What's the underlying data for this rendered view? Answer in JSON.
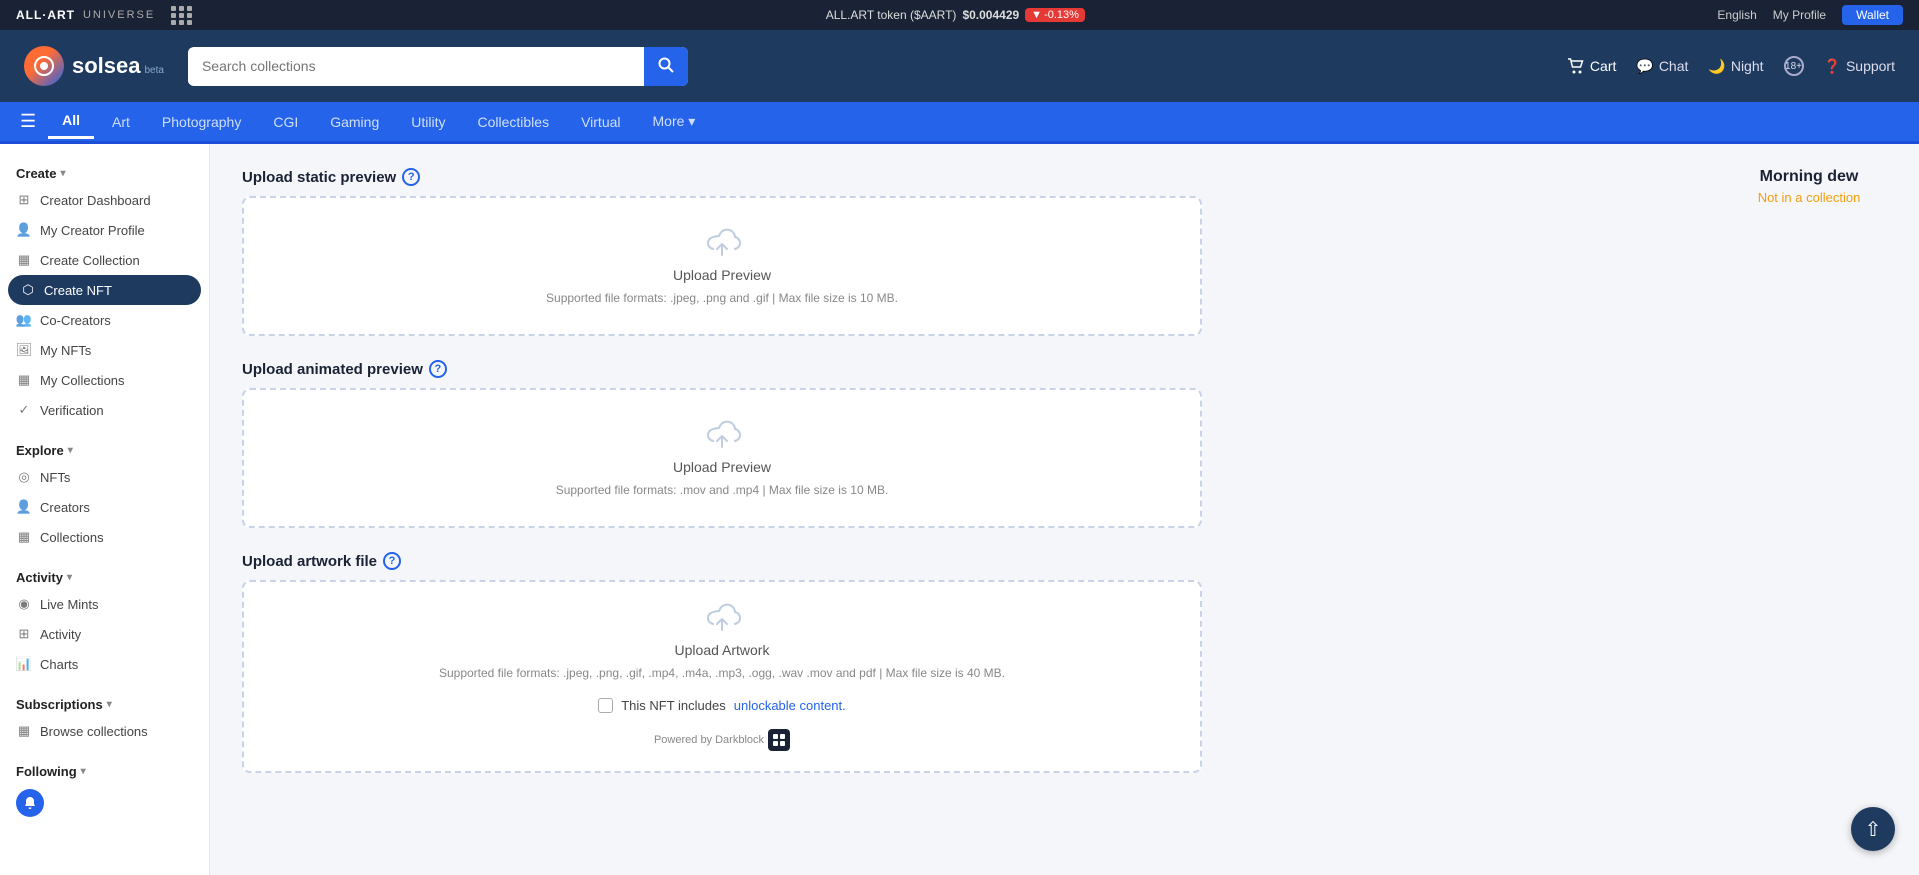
{
  "topbar": {
    "brand": "ALL·ART",
    "universe": "UNIVERSE",
    "token_label": "ALL.ART token ($AART)",
    "token_price": "$0.004429",
    "token_change": "-0.13%",
    "language": "English",
    "profile": "My Profile",
    "wallet": "Wallet"
  },
  "header": {
    "logo_text": "solsea",
    "logo_beta": "beta",
    "search_placeholder": "Search collections",
    "cart": "Cart",
    "chat": "Chat",
    "night": "Night",
    "age": "18+",
    "support": "Support"
  },
  "nav": {
    "items": [
      {
        "label": "All",
        "active": true
      },
      {
        "label": "Art",
        "active": false
      },
      {
        "label": "Photography",
        "active": false
      },
      {
        "label": "CGI",
        "active": false
      },
      {
        "label": "Gaming",
        "active": false
      },
      {
        "label": "Utility",
        "active": false
      },
      {
        "label": "Collectibles",
        "active": false
      },
      {
        "label": "Virtual",
        "active": false
      },
      {
        "label": "More",
        "active": false
      }
    ]
  },
  "sidebar": {
    "create_section": "Create",
    "create_items": [
      {
        "label": "Creator Dashboard",
        "icon": "grid"
      },
      {
        "label": "My Creator Profile",
        "icon": "user"
      },
      {
        "label": "Create Collection",
        "icon": "collection"
      },
      {
        "label": "Create NFT",
        "icon": "nft",
        "active": true
      },
      {
        "label": "Co-Creators",
        "icon": "co"
      },
      {
        "label": "My NFTs",
        "icon": "nft-list"
      },
      {
        "label": "My Collections",
        "icon": "collections"
      },
      {
        "label": "Verification",
        "icon": "verify"
      }
    ],
    "explore_section": "Explore",
    "explore_items": [
      {
        "label": "NFTs",
        "icon": "nfts"
      },
      {
        "label": "Creators",
        "icon": "creators"
      },
      {
        "label": "Collections",
        "icon": "collections2"
      }
    ],
    "activity_section": "Activity",
    "activity_items": [
      {
        "label": "Live Mints",
        "icon": "live"
      },
      {
        "label": "Activity",
        "icon": "activity"
      },
      {
        "label": "Charts",
        "icon": "charts"
      }
    ],
    "subscriptions_section": "Subscriptions",
    "subscriptions_items": [
      {
        "label": "Browse collections",
        "icon": "browse"
      }
    ],
    "following_section": "Following"
  },
  "main": {
    "sections": [
      {
        "id": "static-preview",
        "label": "Upload static preview",
        "upload_title": "Upload Preview",
        "upload_hint": "Supported file formats: .jpeg, .png and .gif | Max file size is 10 MB."
      },
      {
        "id": "animated-preview",
        "label": "Upload animated preview",
        "upload_title": "Upload Preview",
        "upload_hint": "Supported file formats: .mov and .mp4 | Max file size is 10 MB."
      },
      {
        "id": "artwork-file",
        "label": "Upload artwork file",
        "upload_title": "Upload Artwork",
        "upload_hint": "Supported file formats: .jpeg, .png, .gif, .mp4, .m4a, .mp3, .ogg, .wav .mov and pdf | Max file size is 40 MB.",
        "unlockable_text": "This NFT includes",
        "unlockable_link": "unlockable content.",
        "powered_by": "Powered by Darkblock"
      }
    ]
  },
  "right_panel": {
    "title": "Morning dew",
    "subtitle": "Not in a collection"
  }
}
